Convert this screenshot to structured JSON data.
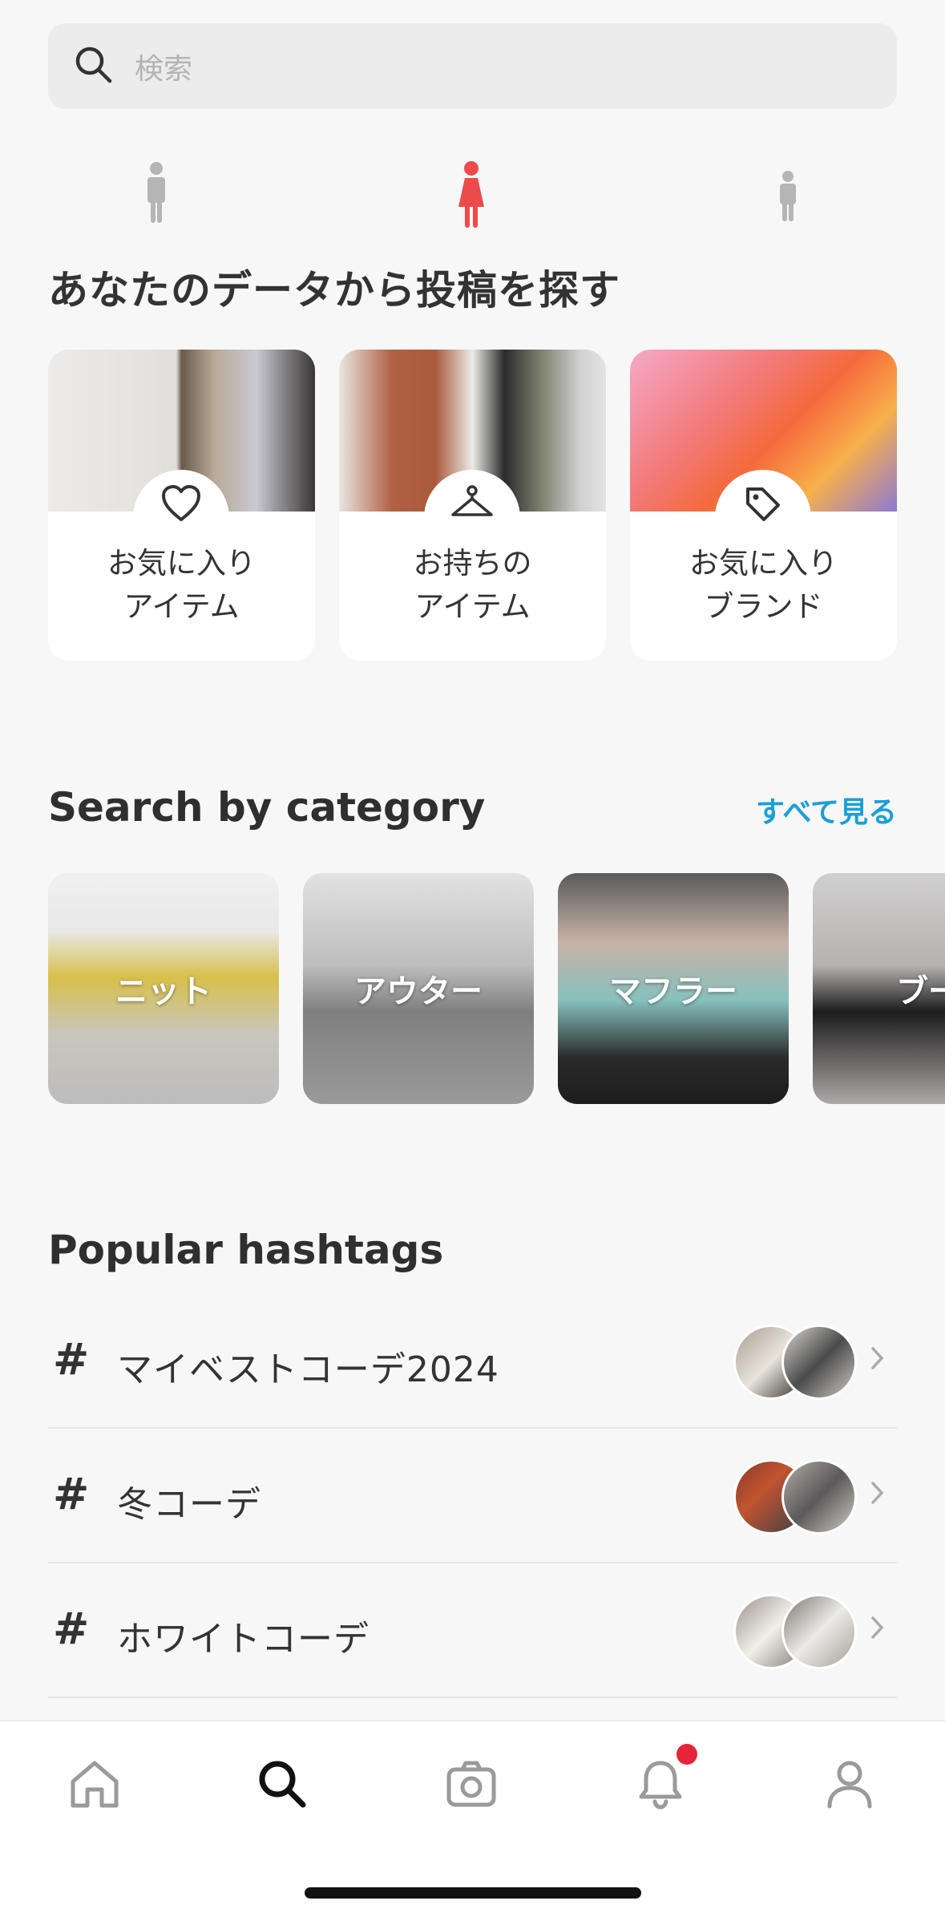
{
  "search": {
    "placeholder": "検索"
  },
  "gender_selector": {
    "options": [
      "men",
      "women",
      "kids"
    ],
    "selected": "women",
    "accent": "#ec4b4e"
  },
  "data_section": {
    "title": "あなたのデータから投稿を探す",
    "cards": [
      {
        "label": "お気に入り\nアイテム",
        "icon": "heart-icon"
      },
      {
        "label": "お持ちの\nアイテム",
        "icon": "hanger-icon"
      },
      {
        "label": "お気に入り\nブランド",
        "icon": "tag-icon"
      }
    ]
  },
  "category_section": {
    "title": "Search by category",
    "see_all": "すべて見る",
    "items": [
      {
        "label": "ニット"
      },
      {
        "label": "アウター"
      },
      {
        "label": "マフラー"
      },
      {
        "label": "ブー"
      }
    ]
  },
  "hashtag_section": {
    "title": "Popular hashtags",
    "items": [
      {
        "symbol": "#",
        "tag": "マイベストコーデ2024"
      },
      {
        "symbol": "#",
        "tag": "冬コーデ"
      },
      {
        "symbol": "#",
        "tag": "ホワイトコーデ"
      }
    ]
  },
  "tab_bar": {
    "tabs": [
      "home-icon",
      "search-icon",
      "camera-icon",
      "bell-icon",
      "profile-icon"
    ],
    "active": "search-icon",
    "notification_color": "#e6253a"
  }
}
